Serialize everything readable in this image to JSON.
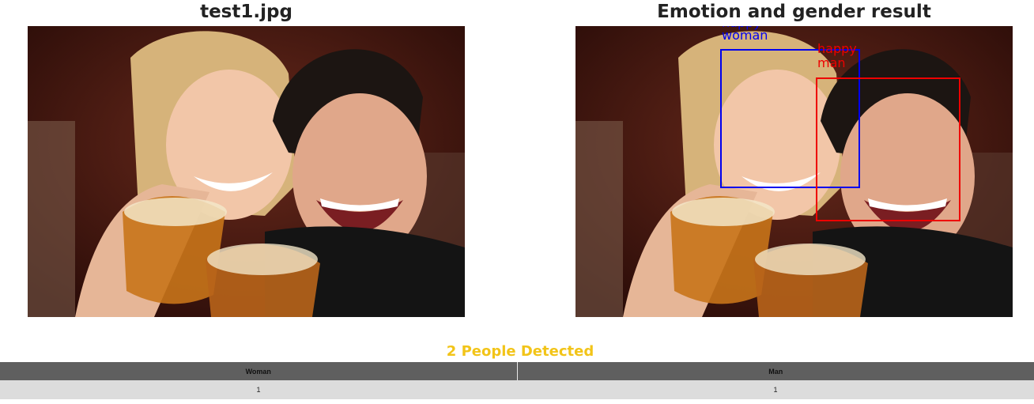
{
  "left_panel": {
    "title": "test1.jpg"
  },
  "right_panel": {
    "title": "Emotion and gender result",
    "detections": [
      {
        "emotion": "happy",
        "gender": "woman",
        "color": "#0000ee"
      },
      {
        "emotion": "happy",
        "gender": "man",
        "color": "#ee0000"
      }
    ]
  },
  "summary": {
    "text": "2 People Detected",
    "color": "#f2c418"
  },
  "table": {
    "headers": [
      "Woman",
      "Man"
    ],
    "rows": [
      [
        "1",
        "1"
      ]
    ]
  },
  "colors": {
    "header_background": "#5f5f5f",
    "row_background": "#dcdcdc"
  }
}
